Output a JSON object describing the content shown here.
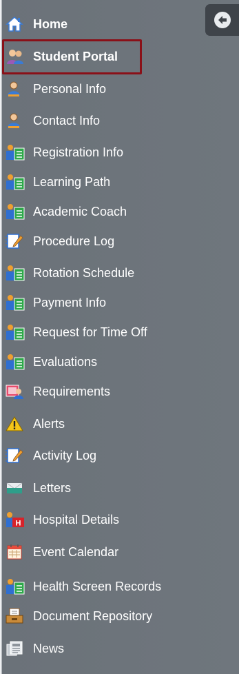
{
  "menu": {
    "items": [
      {
        "label": "Home",
        "icon": "home-icon",
        "bold": true
      },
      {
        "label": "Student Portal",
        "icon": "student-portal-icon",
        "bold": true,
        "selected": true
      },
      {
        "label": "Personal Info",
        "icon": "person-icon"
      },
      {
        "label": "Contact Info",
        "icon": "person-icon"
      },
      {
        "label": "Registration Info",
        "icon": "clipboard-person-icon"
      },
      {
        "label": "Learning Path",
        "icon": "clipboard-person-icon"
      },
      {
        "label": "Academic Coach",
        "icon": "clipboard-person-icon"
      },
      {
        "label": "Procedure Log",
        "icon": "notebook-pen-icon"
      },
      {
        "label": "Rotation Schedule",
        "icon": "clipboard-person-icon"
      },
      {
        "label": "Payment Info",
        "icon": "clipboard-person-icon"
      },
      {
        "label": "Request for Time Off",
        "icon": "clipboard-person-icon"
      },
      {
        "label": "Evaluations",
        "icon": "clipboard-person-icon"
      },
      {
        "label": "Requirements",
        "icon": "requirements-icon"
      },
      {
        "label": "Alerts",
        "icon": "warning-icon"
      },
      {
        "label": "Activity Log",
        "icon": "notebook-pen-icon"
      },
      {
        "label": "Letters",
        "icon": "letter-icon"
      },
      {
        "label": "Hospital Details",
        "icon": "hospital-icon"
      },
      {
        "label": "Event Calendar",
        "icon": "calendar-icon"
      },
      {
        "label": "Health Screen Records",
        "icon": "clipboard-person-icon"
      },
      {
        "label": "Document Repository",
        "icon": "document-repository-icon"
      },
      {
        "label": "News",
        "icon": "news-icon"
      }
    ]
  },
  "colors": {
    "sidebar_bg": "#6f767d",
    "text": "#ffffff",
    "highlight_border": "#8a1018",
    "collapse_tab_bg": "#3f444a"
  },
  "collapse_button": {
    "icon": "arrow-left-icon"
  }
}
